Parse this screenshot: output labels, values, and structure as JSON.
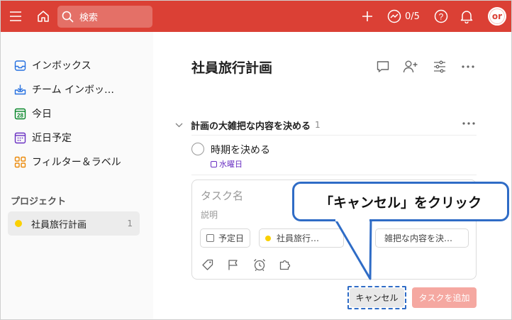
{
  "topbar": {
    "search_placeholder": "検索",
    "karma_count": "0/5",
    "avatar_initials": "or",
    "brand_color": "#db4035"
  },
  "sidebar": {
    "items": [
      {
        "label": "インボックス",
        "icon": "inbox-icon"
      },
      {
        "label": "チーム インボッ…",
        "icon": "team-inbox-icon"
      },
      {
        "label": "今日",
        "icon": "today-calendar-icon"
      },
      {
        "label": "近日予定",
        "icon": "upcoming-calendar-icon"
      },
      {
        "label": "フィルター＆ラベル",
        "icon": "filters-labels-icon"
      }
    ],
    "projects_heading": "プロジェクト",
    "project": {
      "name": "社員旅行計画",
      "count": "1",
      "color": "#fad000"
    }
  },
  "main": {
    "title": "社員旅行計画",
    "section": {
      "title": "計画の大雑把な内容を決める",
      "count": "1"
    },
    "task": {
      "title": "時期を決める",
      "due": "水曜日"
    }
  },
  "editor": {
    "taskname_placeholder": "タスク名",
    "description_placeholder": "説明",
    "due_chip": "予定日",
    "project_chip": "社員旅行…",
    "section_chip": "雑把な内容を決…",
    "cancel_label": "キャンセル",
    "add_label": "タスクを追加"
  },
  "callout": {
    "text": "「キャンセル」をクリック",
    "color": "#2f6cc6"
  }
}
